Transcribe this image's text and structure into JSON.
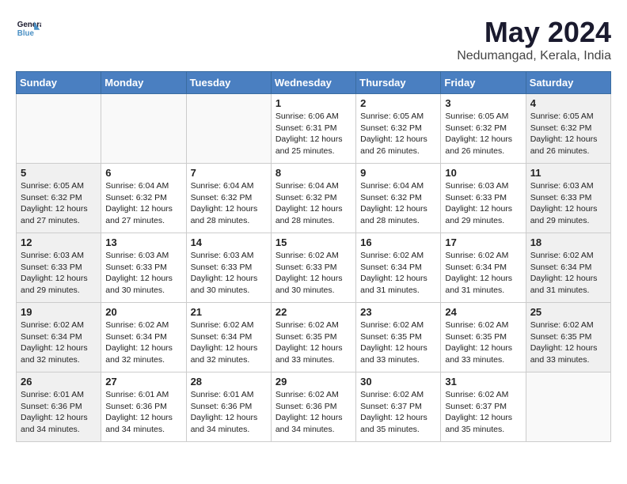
{
  "logo": {
    "line1": "General",
    "line2": "Blue"
  },
  "title": "May 2024",
  "location": "Nedumangad, Kerala, India",
  "weekdays": [
    "Sunday",
    "Monday",
    "Tuesday",
    "Wednesday",
    "Thursday",
    "Friday",
    "Saturday"
  ],
  "weeks": [
    [
      {
        "day": "",
        "info": ""
      },
      {
        "day": "",
        "info": ""
      },
      {
        "day": "",
        "info": ""
      },
      {
        "day": "1",
        "info": "Sunrise: 6:06 AM\nSunset: 6:31 PM\nDaylight: 12 hours\nand 25 minutes."
      },
      {
        "day": "2",
        "info": "Sunrise: 6:05 AM\nSunset: 6:32 PM\nDaylight: 12 hours\nand 26 minutes."
      },
      {
        "day": "3",
        "info": "Sunrise: 6:05 AM\nSunset: 6:32 PM\nDaylight: 12 hours\nand 26 minutes."
      },
      {
        "day": "4",
        "info": "Sunrise: 6:05 AM\nSunset: 6:32 PM\nDaylight: 12 hours\nand 26 minutes."
      }
    ],
    [
      {
        "day": "5",
        "info": "Sunrise: 6:05 AM\nSunset: 6:32 PM\nDaylight: 12 hours\nand 27 minutes."
      },
      {
        "day": "6",
        "info": "Sunrise: 6:04 AM\nSunset: 6:32 PM\nDaylight: 12 hours\nand 27 minutes."
      },
      {
        "day": "7",
        "info": "Sunrise: 6:04 AM\nSunset: 6:32 PM\nDaylight: 12 hours\nand 28 minutes."
      },
      {
        "day": "8",
        "info": "Sunrise: 6:04 AM\nSunset: 6:32 PM\nDaylight: 12 hours\nand 28 minutes."
      },
      {
        "day": "9",
        "info": "Sunrise: 6:04 AM\nSunset: 6:32 PM\nDaylight: 12 hours\nand 28 minutes."
      },
      {
        "day": "10",
        "info": "Sunrise: 6:03 AM\nSunset: 6:33 PM\nDaylight: 12 hours\nand 29 minutes."
      },
      {
        "day": "11",
        "info": "Sunrise: 6:03 AM\nSunset: 6:33 PM\nDaylight: 12 hours\nand 29 minutes."
      }
    ],
    [
      {
        "day": "12",
        "info": "Sunrise: 6:03 AM\nSunset: 6:33 PM\nDaylight: 12 hours\nand 29 minutes."
      },
      {
        "day": "13",
        "info": "Sunrise: 6:03 AM\nSunset: 6:33 PM\nDaylight: 12 hours\nand 30 minutes."
      },
      {
        "day": "14",
        "info": "Sunrise: 6:03 AM\nSunset: 6:33 PM\nDaylight: 12 hours\nand 30 minutes."
      },
      {
        "day": "15",
        "info": "Sunrise: 6:02 AM\nSunset: 6:33 PM\nDaylight: 12 hours\nand 30 minutes."
      },
      {
        "day": "16",
        "info": "Sunrise: 6:02 AM\nSunset: 6:34 PM\nDaylight: 12 hours\nand 31 minutes."
      },
      {
        "day": "17",
        "info": "Sunrise: 6:02 AM\nSunset: 6:34 PM\nDaylight: 12 hours\nand 31 minutes."
      },
      {
        "day": "18",
        "info": "Sunrise: 6:02 AM\nSunset: 6:34 PM\nDaylight: 12 hours\nand 31 minutes."
      }
    ],
    [
      {
        "day": "19",
        "info": "Sunrise: 6:02 AM\nSunset: 6:34 PM\nDaylight: 12 hours\nand 32 minutes."
      },
      {
        "day": "20",
        "info": "Sunrise: 6:02 AM\nSunset: 6:34 PM\nDaylight: 12 hours\nand 32 minutes."
      },
      {
        "day": "21",
        "info": "Sunrise: 6:02 AM\nSunset: 6:34 PM\nDaylight: 12 hours\nand 32 minutes."
      },
      {
        "day": "22",
        "info": "Sunrise: 6:02 AM\nSunset: 6:35 PM\nDaylight: 12 hours\nand 33 minutes."
      },
      {
        "day": "23",
        "info": "Sunrise: 6:02 AM\nSunset: 6:35 PM\nDaylight: 12 hours\nand 33 minutes."
      },
      {
        "day": "24",
        "info": "Sunrise: 6:02 AM\nSunset: 6:35 PM\nDaylight: 12 hours\nand 33 minutes."
      },
      {
        "day": "25",
        "info": "Sunrise: 6:02 AM\nSunset: 6:35 PM\nDaylight: 12 hours\nand 33 minutes."
      }
    ],
    [
      {
        "day": "26",
        "info": "Sunrise: 6:01 AM\nSunset: 6:36 PM\nDaylight: 12 hours\nand 34 minutes."
      },
      {
        "day": "27",
        "info": "Sunrise: 6:01 AM\nSunset: 6:36 PM\nDaylight: 12 hours\nand 34 minutes."
      },
      {
        "day": "28",
        "info": "Sunrise: 6:01 AM\nSunset: 6:36 PM\nDaylight: 12 hours\nand 34 minutes."
      },
      {
        "day": "29",
        "info": "Sunrise: 6:02 AM\nSunset: 6:36 PM\nDaylight: 12 hours\nand 34 minutes."
      },
      {
        "day": "30",
        "info": "Sunrise: 6:02 AM\nSunset: 6:37 PM\nDaylight: 12 hours\nand 35 minutes."
      },
      {
        "day": "31",
        "info": "Sunrise: 6:02 AM\nSunset: 6:37 PM\nDaylight: 12 hours\nand 35 minutes."
      },
      {
        "day": "",
        "info": ""
      }
    ]
  ]
}
